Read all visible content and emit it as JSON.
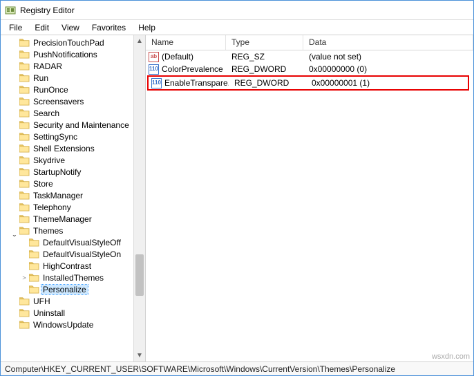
{
  "window": {
    "title": "Registry Editor"
  },
  "menu": {
    "file": "File",
    "edit": "Edit",
    "view": "View",
    "favorites": "Favorites",
    "help": "Help"
  },
  "list": {
    "headers": {
      "name": "Name",
      "type": "Type",
      "data": "Data"
    },
    "rows": [
      {
        "icon": "str",
        "name": "(Default)",
        "type": "REG_SZ",
        "data": "(value not set)"
      },
      {
        "icon": "bin",
        "name": "ColorPrevalence",
        "type": "REG_DWORD",
        "data": "0x00000000 (0)"
      },
      {
        "icon": "bin",
        "name": "EnableTranspare...",
        "type": "REG_DWORD",
        "data": "0x00000001 (1)",
        "highlighted": true
      }
    ]
  },
  "tree": {
    "items": [
      {
        "depth": 1,
        "toggle": "",
        "label": "PrecisionTouchPad"
      },
      {
        "depth": 1,
        "toggle": "",
        "label": "PushNotifications"
      },
      {
        "depth": 1,
        "toggle": "",
        "label": "RADAR"
      },
      {
        "depth": 1,
        "toggle": "",
        "label": "Run"
      },
      {
        "depth": 1,
        "toggle": "",
        "label": "RunOnce"
      },
      {
        "depth": 1,
        "toggle": "",
        "label": "Screensavers"
      },
      {
        "depth": 1,
        "toggle": "",
        "label": "Search"
      },
      {
        "depth": 1,
        "toggle": "",
        "label": "Security and Maintenance"
      },
      {
        "depth": 1,
        "toggle": "",
        "label": "SettingSync"
      },
      {
        "depth": 1,
        "toggle": "",
        "label": "Shell Extensions"
      },
      {
        "depth": 1,
        "toggle": "",
        "label": "Skydrive"
      },
      {
        "depth": 1,
        "toggle": "",
        "label": "StartupNotify"
      },
      {
        "depth": 1,
        "toggle": "",
        "label": "Store"
      },
      {
        "depth": 1,
        "toggle": "",
        "label": "TaskManager"
      },
      {
        "depth": 1,
        "toggle": "",
        "label": "Telephony"
      },
      {
        "depth": 1,
        "toggle": "",
        "label": "ThemeManager"
      },
      {
        "depth": 1,
        "toggle": "open",
        "label": "Themes"
      },
      {
        "depth": 2,
        "toggle": "",
        "label": "DefaultVisualStyleOff"
      },
      {
        "depth": 2,
        "toggle": "",
        "label": "DefaultVisualStyleOn"
      },
      {
        "depth": 2,
        "toggle": "",
        "label": "HighContrast"
      },
      {
        "depth": 2,
        "toggle": "closed",
        "label": "InstalledThemes"
      },
      {
        "depth": 2,
        "toggle": "",
        "label": "Personalize",
        "selected": true
      },
      {
        "depth": 1,
        "toggle": "",
        "label": "UFH"
      },
      {
        "depth": 1,
        "toggle": "",
        "label": "Uninstall"
      },
      {
        "depth": 1,
        "toggle": "",
        "label": "WindowsUpdate"
      }
    ]
  },
  "statusbar": {
    "path": "Computer\\HKEY_CURRENT_USER\\SOFTWARE\\Microsoft\\Windows\\CurrentVersion\\Themes\\Personalize"
  },
  "watermark": "wsxdn.com"
}
